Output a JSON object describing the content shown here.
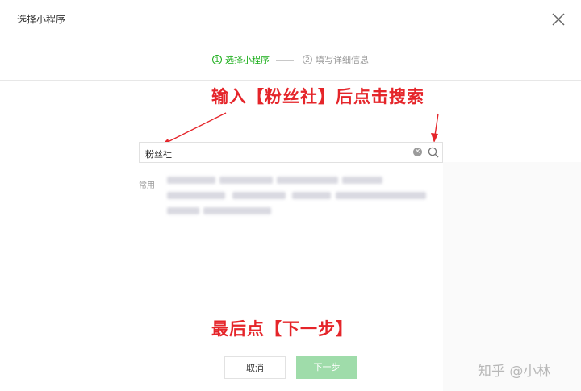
{
  "dialog": {
    "title": "选择小程序"
  },
  "steps": [
    {
      "number": "1",
      "label": "选择小程序",
      "state": "active"
    },
    {
      "number": "2",
      "label": "填写详细信息",
      "state": "todo"
    }
  ],
  "annotations": {
    "top": "输入【粉丝社】后点击搜索",
    "bottom": "最后点【下一步】",
    "color": "#e5252a"
  },
  "search": {
    "value": "粉丝社",
    "clear_icon": "clear-icon",
    "search_icon": "search-icon"
  },
  "common": {
    "label": "常用"
  },
  "buttons": {
    "cancel": "取消",
    "next": "下一步"
  },
  "watermark": "知乎 @小林",
  "colors": {
    "accent": "#1aad19",
    "next_button": "#9fdcaa"
  }
}
